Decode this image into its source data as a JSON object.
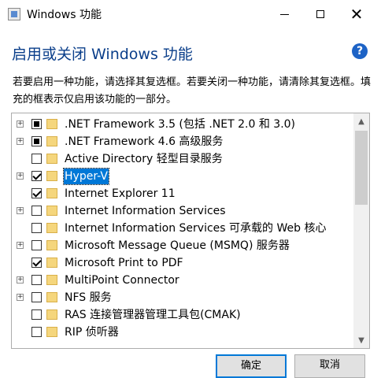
{
  "window": {
    "title": "Windows 功能",
    "close_glyph": "✕"
  },
  "header": {
    "title": "启用或关闭 Windows 功能",
    "help_glyph": "?"
  },
  "description": "若要启用一种功能，请选择其复选框。若要关闭一种功能，请清除其复选框。填充的框表示仅启用该功能的一部分。",
  "features": [
    {
      "label": ".NET Framework 3.5 (包括 .NET 2.0 和 3.0)",
      "expandable": true,
      "state": "partial"
    },
    {
      "label": ".NET Framework 4.6 高级服务",
      "expandable": true,
      "state": "partial"
    },
    {
      "label": "Active Directory 轻型目录服务",
      "expandable": false,
      "state": "unchecked"
    },
    {
      "label": "Hyper-V",
      "expandable": true,
      "state": "checked",
      "selected": true
    },
    {
      "label": "Internet Explorer 11",
      "expandable": false,
      "state": "checked"
    },
    {
      "label": "Internet Information Services",
      "expandable": true,
      "state": "unchecked"
    },
    {
      "label": "Internet Information Services 可承载的 Web 核心",
      "expandable": false,
      "state": "unchecked"
    },
    {
      "label": "Microsoft Message Queue (MSMQ) 服务器",
      "expandable": true,
      "state": "unchecked"
    },
    {
      "label": "Microsoft Print to PDF",
      "expandable": false,
      "state": "checked"
    },
    {
      "label": "MultiPoint Connector",
      "expandable": true,
      "state": "unchecked"
    },
    {
      "label": "NFS 服务",
      "expandable": true,
      "state": "unchecked"
    },
    {
      "label": "RAS 连接管理器管理工具包(CMAK)",
      "expandable": false,
      "state": "unchecked"
    },
    {
      "label": "RIP 侦听器",
      "expandable": false,
      "state": "unchecked"
    }
  ],
  "buttons": {
    "ok": "确定",
    "cancel": "取消"
  },
  "colors": {
    "accent": "#0078d7",
    "header": "#0a3e8a"
  }
}
